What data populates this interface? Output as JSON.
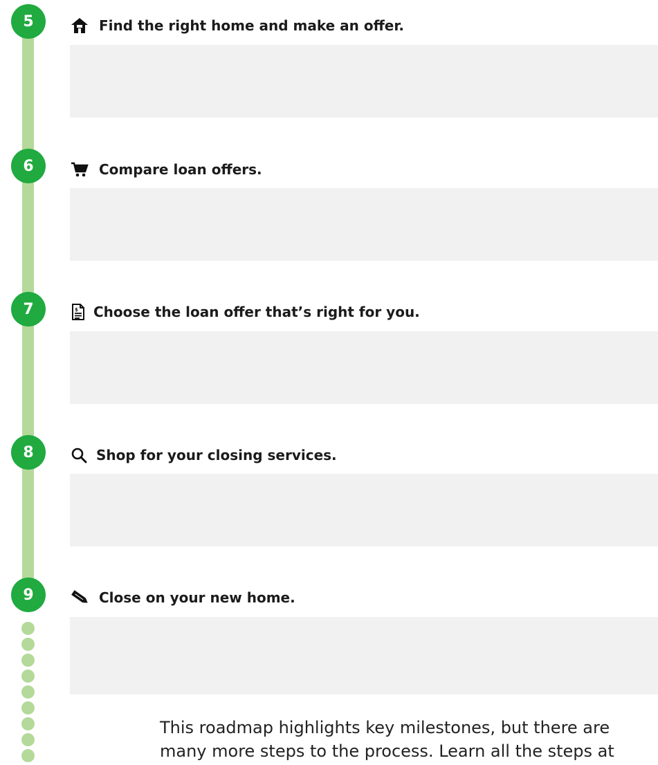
{
  "steps": [
    {
      "number": "5",
      "icon": "house-icon",
      "title": "Find the right home and make an offer."
    },
    {
      "number": "6",
      "icon": "shopping-cart-icon",
      "title": "Compare loan offers."
    },
    {
      "number": "7",
      "icon": "document-icon",
      "title": "Choose the loan offer that’s right for you."
    },
    {
      "number": "8",
      "icon": "search-icon",
      "title": "Shop for your closing services."
    },
    {
      "number": "9",
      "icon": "pencil-icon",
      "title": "Close on your new home."
    }
  ],
  "footer": {
    "line1": "This roadmap highlights key milestones, but there are",
    "line2": "many more steps to the process. Learn all the steps at"
  },
  "colors": {
    "badge": "#20aa3f",
    "rail": "#b4d99a",
    "box": "#f1f1f1"
  }
}
